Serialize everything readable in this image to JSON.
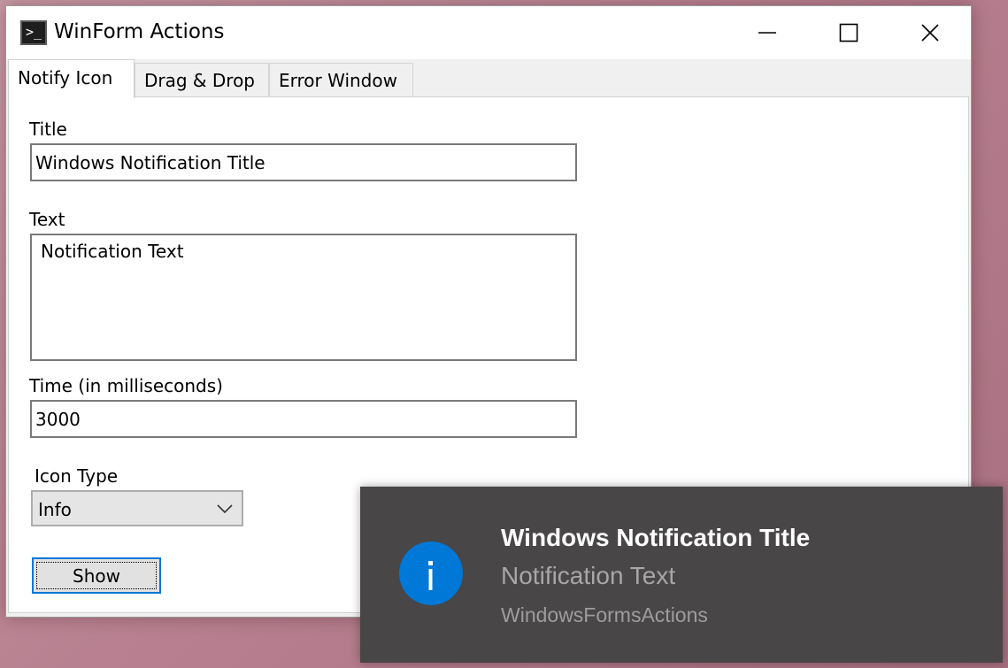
{
  "window": {
    "title": "WinForm Actions",
    "app_icon": "console-icon",
    "app_icon_glyph": ">_",
    "controls": [
      "minimize-icon",
      "maximize-icon",
      "close-icon"
    ]
  },
  "tabs": [
    {
      "label": "Notify Icon",
      "active": true
    },
    {
      "label": "Drag & Drop",
      "active": false
    },
    {
      "label": "Error Window",
      "active": false
    }
  ],
  "form": {
    "title_label": "Title",
    "title_value": "Windows Notification Title",
    "text_label": "Text",
    "text_value": "Notification Text",
    "time_label": "Time (in milliseconds)",
    "time_value": "3000",
    "icon_type_label": "Icon Type",
    "icon_type_value": "Info",
    "show_label": "Show"
  },
  "toast": {
    "icon": "info-icon",
    "title": "Windows Notification Title",
    "text": "Notification Text",
    "app_name": "WindowsFormsActions",
    "accent_color": "#0078d7",
    "background_color": "#484646"
  }
}
